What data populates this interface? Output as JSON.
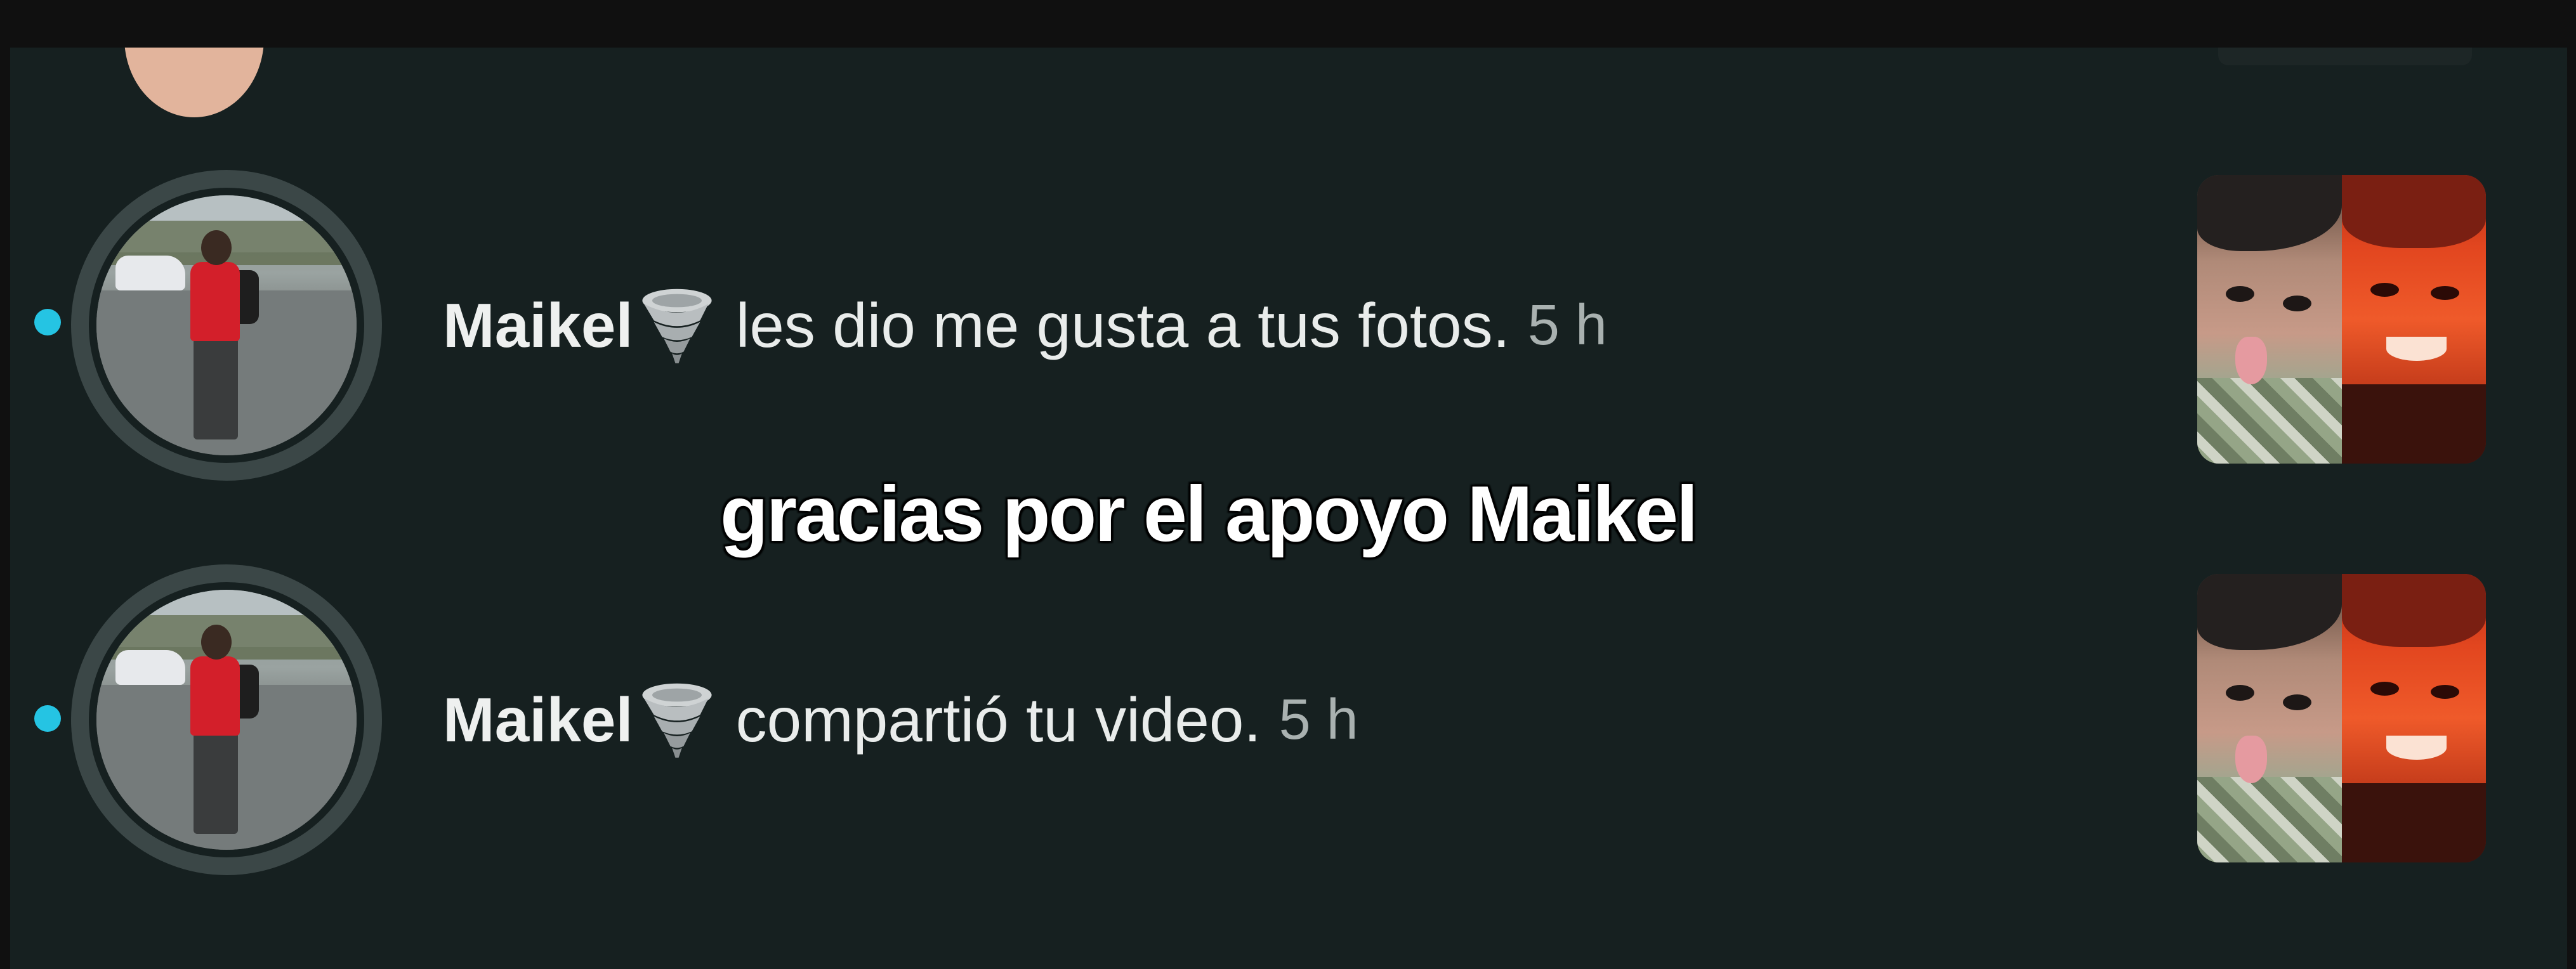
{
  "notifications": [
    {
      "user_name": "Maikel",
      "emoji_icon": "tornado-icon",
      "action": "les dio me gusta a tus fotos.",
      "time": "5 h",
      "unread": true
    },
    {
      "user_name": "Maikel",
      "emoji_icon": "tornado-icon",
      "action": "compartió tu video.",
      "time": "5 h",
      "unread": true
    }
  ],
  "caption": "gracias por el apoyo Maikel",
  "colors": {
    "background": "#162020",
    "unread_dot": "#25c4e3",
    "avatar_ring": "#3b4747",
    "time_text": "#a9b1b0"
  }
}
